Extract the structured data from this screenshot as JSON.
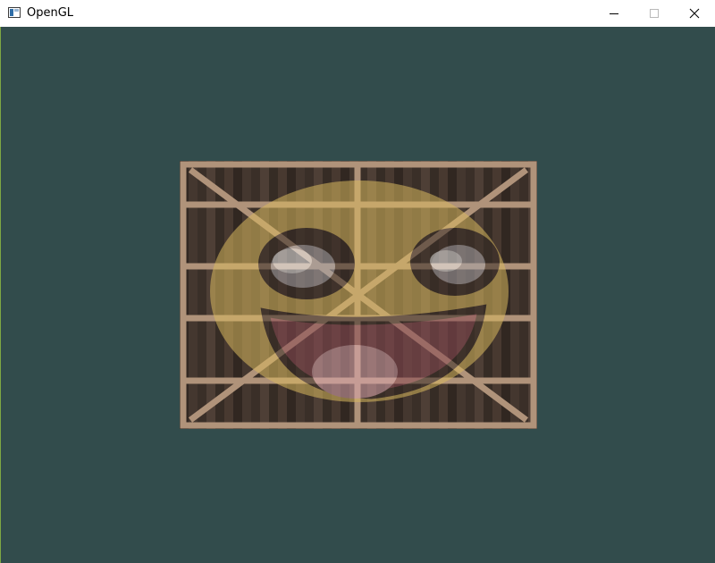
{
  "window": {
    "title": "OpenGL",
    "icon": "application-window-icon",
    "controls": {
      "minimize_icon": "minimize-icon",
      "maximize_icon": "maximize-icon",
      "close_icon": "close-icon"
    }
  },
  "scene": {
    "clear_color": "#324c4c",
    "crate_color": "#3d3129",
    "frame_color": "#b0937a",
    "smiley_color": "#d9b95f",
    "mouth_color": "#8a4b55"
  }
}
